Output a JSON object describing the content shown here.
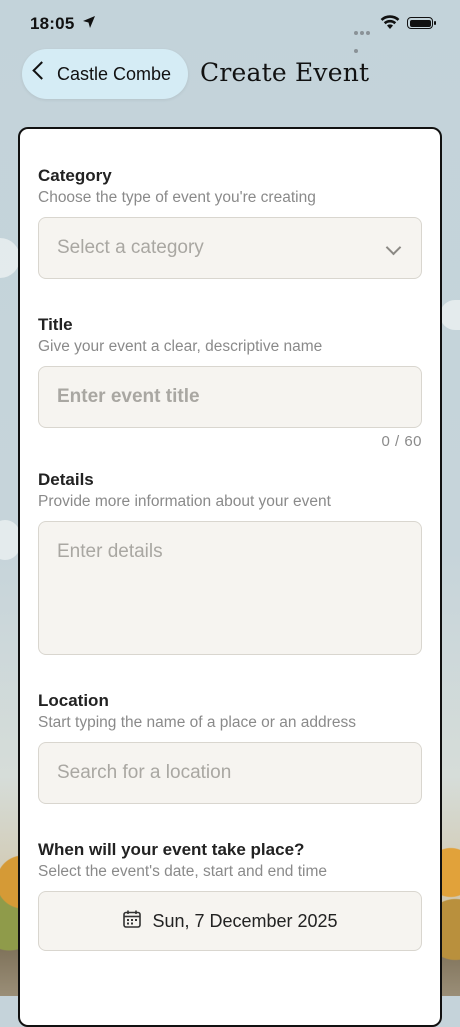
{
  "status_bar": {
    "time": "18:05",
    "location_icon": "location-arrow-icon",
    "wifi_icon": "wifi-icon",
    "battery_icon": "battery-icon"
  },
  "nav": {
    "back_label": "Castle Combe",
    "back_icon": "chevron-left-icon",
    "title": "Create Event"
  },
  "form": {
    "category": {
      "label": "Category",
      "hint": "Choose the type of event you're creating",
      "placeholder": "Select a category",
      "icon": "chevron-down-icon"
    },
    "title": {
      "label": "Title",
      "hint": "Give your event a clear, descriptive name",
      "placeholder": "Enter event title",
      "counter": "0 / 60"
    },
    "details": {
      "label": "Details",
      "hint": "Provide more information about your event",
      "placeholder": "Enter details"
    },
    "location": {
      "label": "Location",
      "hint": "Start typing the name of a place or an address",
      "placeholder": "Search for a location"
    },
    "when": {
      "label": "When will your event take place?",
      "hint": "Select the event's date, start and end time",
      "date": "Sun, 7 December 2025",
      "icon": "calendar-icon"
    }
  },
  "colors": {
    "back_button_bg": "#d5ecf5",
    "field_bg": "#f6f4f0",
    "placeholder": "#a9a7a2",
    "hint": "#8a8a8a"
  }
}
